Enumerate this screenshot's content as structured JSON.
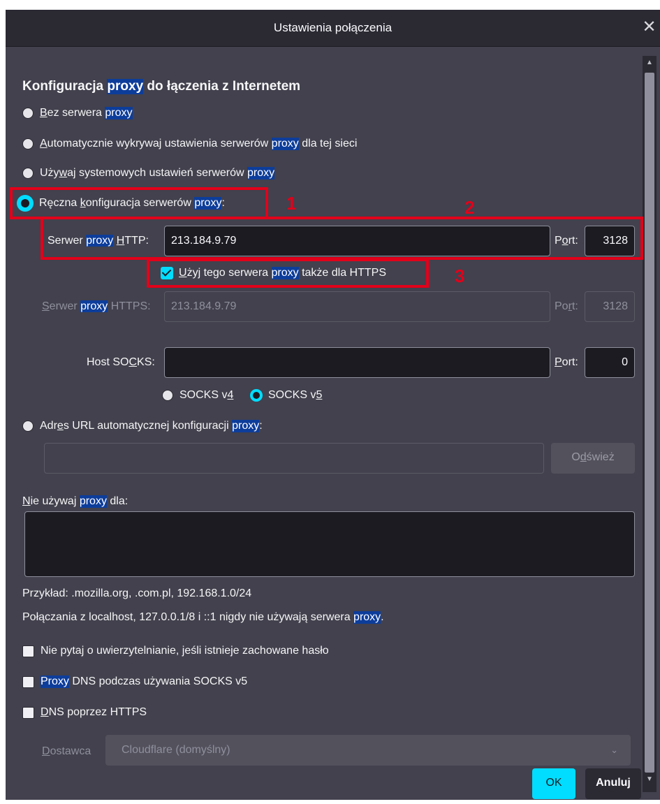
{
  "dialog": {
    "title": "Ustawienia połączenia",
    "close_icon": "close-icon"
  },
  "section": {
    "pre": "Konfiguracja ",
    "hl": "proxy",
    "post": " do łączenia z Internetem"
  },
  "opt_none": {
    "u": "B",
    "pre": "ez serwera ",
    "hl": "proxy"
  },
  "opt_auto": {
    "u": "A",
    "pre": "utomatycznie wykrywaj ustawienia serwerów ",
    "hl": "proxy",
    "post": " dla tej sieci"
  },
  "opt_system": {
    "a": "Uży",
    "u": "w",
    "b": "aj systemowych ustawień serwerów ",
    "hl": "proxy"
  },
  "opt_manual": {
    "a": "Ręczna ",
    "u": "k",
    "b": "onfiguracja serwerów ",
    "hl": "proxy",
    "post": ":"
  },
  "http": {
    "lbl_pre": "Serwer ",
    "lbl_hl": "proxy",
    "lbl_u": "H",
    "lbl_post": "TTP:",
    "value": "213.184.9.79",
    "port_a": "P",
    "port_u": "o",
    "port_b": "rt:",
    "port": "3128"
  },
  "https_same": {
    "u": "U",
    "pre": "żyj tego serwera ",
    "hl": "proxy",
    "post": " także dla HTTPS"
  },
  "https": {
    "lbl_u": "S",
    "lbl_a": "erwer ",
    "lbl_hl": "proxy",
    "lbl_post": " HTTPS:",
    "value": "213.184.9.79",
    "port_a": "Po",
    "port_u": "r",
    "port_b": "t:",
    "port": "3128"
  },
  "socks": {
    "lbl_a": "Host SO",
    "lbl_u": "C",
    "lbl_b": "KS:",
    "value": "",
    "port_u": "P",
    "port_b": "ort:",
    "port": "0",
    "v4_a": "SOCKS v",
    "v4_u": "4",
    "v5_a": "SOCKS v",
    "v5_u": "5"
  },
  "opt_pac": {
    "a": "Adr",
    "u": "e",
    "b": "s URL automatycznej konfiguracji ",
    "hl": "proxy",
    "post": ":"
  },
  "pac": {
    "value": "",
    "reload_a": "O",
    "reload_u": "d",
    "reload_b": "św",
    "reload_c": "ie",
    "reload_d": "ż"
  },
  "noproxy": {
    "u": "N",
    "a": "ie używaj ",
    "hl": "proxy",
    "b": " dla:",
    "value": ""
  },
  "example": "Przykład: .mozilla.org, .com.pl, 192.168.1.0/24",
  "localhost": {
    "pre": "Połączania z localhost, 127.0.0.1/8 i ::1 nigdy nie używają serwera ",
    "hl": "proxy",
    "post": "."
  },
  "chk_auth": "Nie pytaj o uwierzytelnianie, jeśli istnieje zachowane hasło",
  "chk_dns": {
    "hl": "Proxy",
    "post": " DNS podczas używania SOCKS v5"
  },
  "chk_doh": {
    "u": "D",
    "post": "NS poprzez HTTPS"
  },
  "provider": {
    "u": "D",
    "b": "ostawca",
    "value": "Cloudflare (domyślny)"
  },
  "buttons": {
    "ok": "OK",
    "cancel": "Anuluj"
  },
  "annotations": [
    "1",
    "2",
    "3"
  ],
  "colors": {
    "accent": "#00ddff",
    "highlight": "#0d3d9b",
    "annotation": "#e2001a",
    "dialog_bg": "#42414d"
  }
}
